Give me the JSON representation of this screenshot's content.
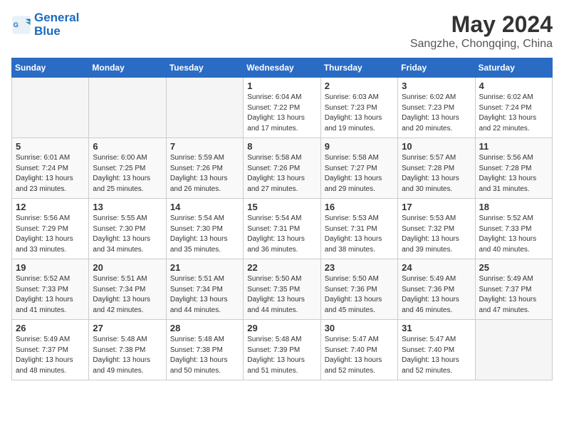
{
  "logo": {
    "line1": "General",
    "line2": "Blue"
  },
  "title": "May 2024",
  "location": "Sangzhe, Chongqing, China",
  "weekdays": [
    "Sunday",
    "Monday",
    "Tuesday",
    "Wednesday",
    "Thursday",
    "Friday",
    "Saturday"
  ],
  "weeks": [
    [
      {
        "day": "",
        "empty": true
      },
      {
        "day": "",
        "empty": true
      },
      {
        "day": "",
        "empty": true
      },
      {
        "day": "1",
        "sunrise": "6:04 AM",
        "sunset": "7:22 PM",
        "daylight": "13 hours and 17 minutes."
      },
      {
        "day": "2",
        "sunrise": "6:03 AM",
        "sunset": "7:23 PM",
        "daylight": "13 hours and 19 minutes."
      },
      {
        "day": "3",
        "sunrise": "6:02 AM",
        "sunset": "7:23 PM",
        "daylight": "13 hours and 20 minutes."
      },
      {
        "day": "4",
        "sunrise": "6:02 AM",
        "sunset": "7:24 PM",
        "daylight": "13 hours and 22 minutes."
      }
    ],
    [
      {
        "day": "5",
        "sunrise": "6:01 AM",
        "sunset": "7:24 PM",
        "daylight": "13 hours and 23 minutes."
      },
      {
        "day": "6",
        "sunrise": "6:00 AM",
        "sunset": "7:25 PM",
        "daylight": "13 hours and 25 minutes."
      },
      {
        "day": "7",
        "sunrise": "5:59 AM",
        "sunset": "7:26 PM",
        "daylight": "13 hours and 26 minutes."
      },
      {
        "day": "8",
        "sunrise": "5:58 AM",
        "sunset": "7:26 PM",
        "daylight": "13 hours and 27 minutes."
      },
      {
        "day": "9",
        "sunrise": "5:58 AM",
        "sunset": "7:27 PM",
        "daylight": "13 hours and 29 minutes."
      },
      {
        "day": "10",
        "sunrise": "5:57 AM",
        "sunset": "7:28 PM",
        "daylight": "13 hours and 30 minutes."
      },
      {
        "day": "11",
        "sunrise": "5:56 AM",
        "sunset": "7:28 PM",
        "daylight": "13 hours and 31 minutes."
      }
    ],
    [
      {
        "day": "12",
        "sunrise": "5:56 AM",
        "sunset": "7:29 PM",
        "daylight": "13 hours and 33 minutes."
      },
      {
        "day": "13",
        "sunrise": "5:55 AM",
        "sunset": "7:30 PM",
        "daylight": "13 hours and 34 minutes."
      },
      {
        "day": "14",
        "sunrise": "5:54 AM",
        "sunset": "7:30 PM",
        "daylight": "13 hours and 35 minutes."
      },
      {
        "day": "15",
        "sunrise": "5:54 AM",
        "sunset": "7:31 PM",
        "daylight": "13 hours and 36 minutes."
      },
      {
        "day": "16",
        "sunrise": "5:53 AM",
        "sunset": "7:31 PM",
        "daylight": "13 hours and 38 minutes."
      },
      {
        "day": "17",
        "sunrise": "5:53 AM",
        "sunset": "7:32 PM",
        "daylight": "13 hours and 39 minutes."
      },
      {
        "day": "18",
        "sunrise": "5:52 AM",
        "sunset": "7:33 PM",
        "daylight": "13 hours and 40 minutes."
      }
    ],
    [
      {
        "day": "19",
        "sunrise": "5:52 AM",
        "sunset": "7:33 PM",
        "daylight": "13 hours and 41 minutes."
      },
      {
        "day": "20",
        "sunrise": "5:51 AM",
        "sunset": "7:34 PM",
        "daylight": "13 hours and 42 minutes."
      },
      {
        "day": "21",
        "sunrise": "5:51 AM",
        "sunset": "7:34 PM",
        "daylight": "13 hours and 44 minutes."
      },
      {
        "day": "22",
        "sunrise": "5:50 AM",
        "sunset": "7:35 PM",
        "daylight": "13 hours and 44 minutes."
      },
      {
        "day": "23",
        "sunrise": "5:50 AM",
        "sunset": "7:36 PM",
        "daylight": "13 hours and 45 minutes."
      },
      {
        "day": "24",
        "sunrise": "5:49 AM",
        "sunset": "7:36 PM",
        "daylight": "13 hours and 46 minutes."
      },
      {
        "day": "25",
        "sunrise": "5:49 AM",
        "sunset": "7:37 PM",
        "daylight": "13 hours and 47 minutes."
      }
    ],
    [
      {
        "day": "26",
        "sunrise": "5:49 AM",
        "sunset": "7:37 PM",
        "daylight": "13 hours and 48 minutes."
      },
      {
        "day": "27",
        "sunrise": "5:48 AM",
        "sunset": "7:38 PM",
        "daylight": "13 hours and 49 minutes."
      },
      {
        "day": "28",
        "sunrise": "5:48 AM",
        "sunset": "7:38 PM",
        "daylight": "13 hours and 50 minutes."
      },
      {
        "day": "29",
        "sunrise": "5:48 AM",
        "sunset": "7:39 PM",
        "daylight": "13 hours and 51 minutes."
      },
      {
        "day": "30",
        "sunrise": "5:47 AM",
        "sunset": "7:40 PM",
        "daylight": "13 hours and 52 minutes."
      },
      {
        "day": "31",
        "sunrise": "5:47 AM",
        "sunset": "7:40 PM",
        "daylight": "13 hours and 52 minutes."
      },
      {
        "day": "",
        "empty": true
      }
    ]
  ]
}
